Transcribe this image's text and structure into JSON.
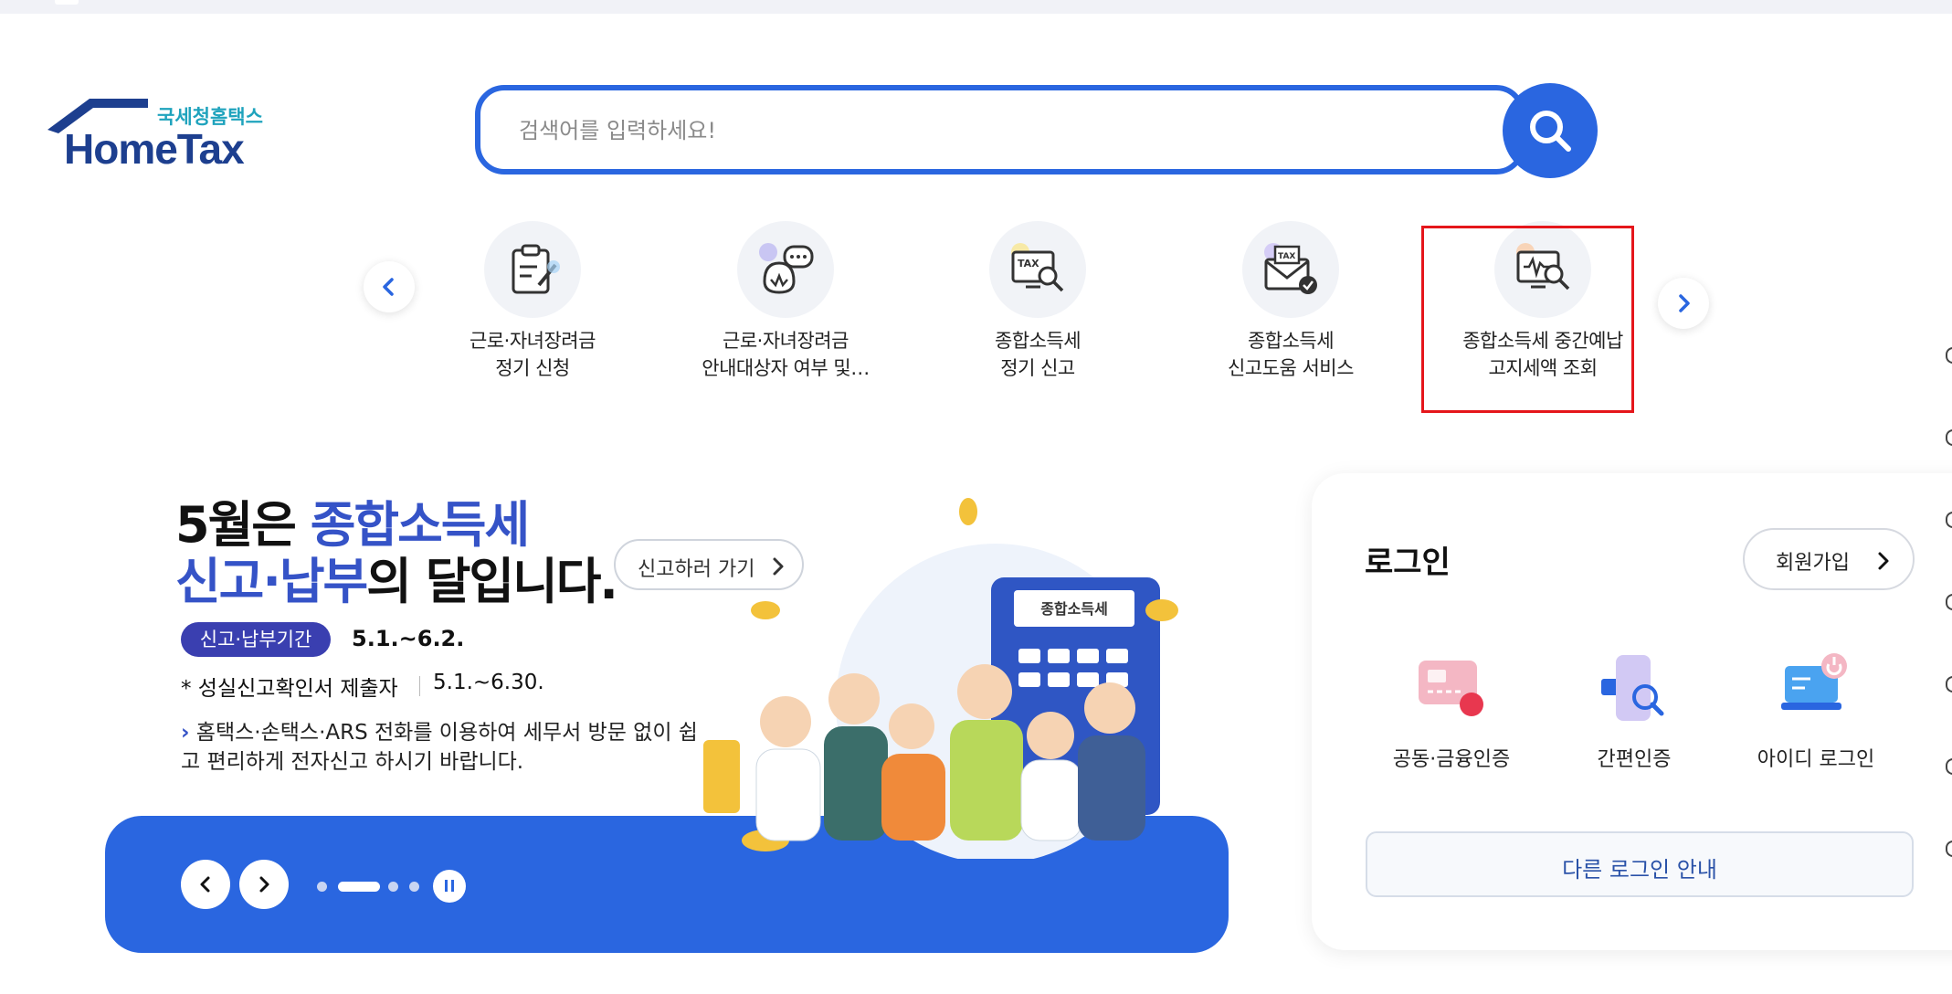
{
  "logo": {
    "sub": "국세청홈택스",
    "main": "HomeTax"
  },
  "search": {
    "placeholder": "검색어를 입력하세요!"
  },
  "quick_menu": [
    {
      "line1": "근로·자녀장려금",
      "line2": "정기 신청",
      "icon": "clipboard-pen-icon"
    },
    {
      "line1": "근로·자녀장려금",
      "line2": "안내대상자 여부 및…",
      "icon": "money-bag-chat-icon"
    },
    {
      "line1": "종합소득세",
      "line2": "정기 신고",
      "icon": "tax-monitor-search-icon"
    },
    {
      "line1": "종합소득세",
      "line2": "신고도움 서비스",
      "icon": "tax-envelope-check-icon"
    },
    {
      "line1": "종합소득세 중간예납",
      "line2": "고지세액 조회",
      "icon": "monitor-won-search-icon"
    }
  ],
  "banner": {
    "h1_plain": "5월은 ",
    "h1_blue": "종합소득세",
    "h2_blue": "신고·납부",
    "h2_plain": "의 달입니다.",
    "cta": "신고하러 가기",
    "period_badge": "신고·납부기간",
    "period_value": "5.1.~6.2.",
    "confirm_label": "* 성실신고확인서 제출자",
    "confirm_value": "5.1.~6.30.",
    "note": "홈택스·손택스·ARS 전화를 이용하여 세무서 방문 없이 쉽고 편리하게 전자신고 하시기 바랍니다.",
    "calculator_label": "종합소득세",
    "slide_count": 4,
    "active_slide": 2
  },
  "login": {
    "title": "로그인",
    "join": "회원가입",
    "options": [
      {
        "label": "공동·금융인증",
        "icon": "certificate-card-icon"
      },
      {
        "label": "간편인증",
        "icon": "phone-search-icon"
      },
      {
        "label": "아이디 로그인",
        "icon": "laptop-power-icon"
      }
    ],
    "other": "다른 로그인 안내"
  },
  "colors": {
    "primary": "#2a66e0",
    "brand_navy": "#1d3f8f",
    "headline_blue": "#3553c7",
    "highlight_red": "#e5161b"
  }
}
